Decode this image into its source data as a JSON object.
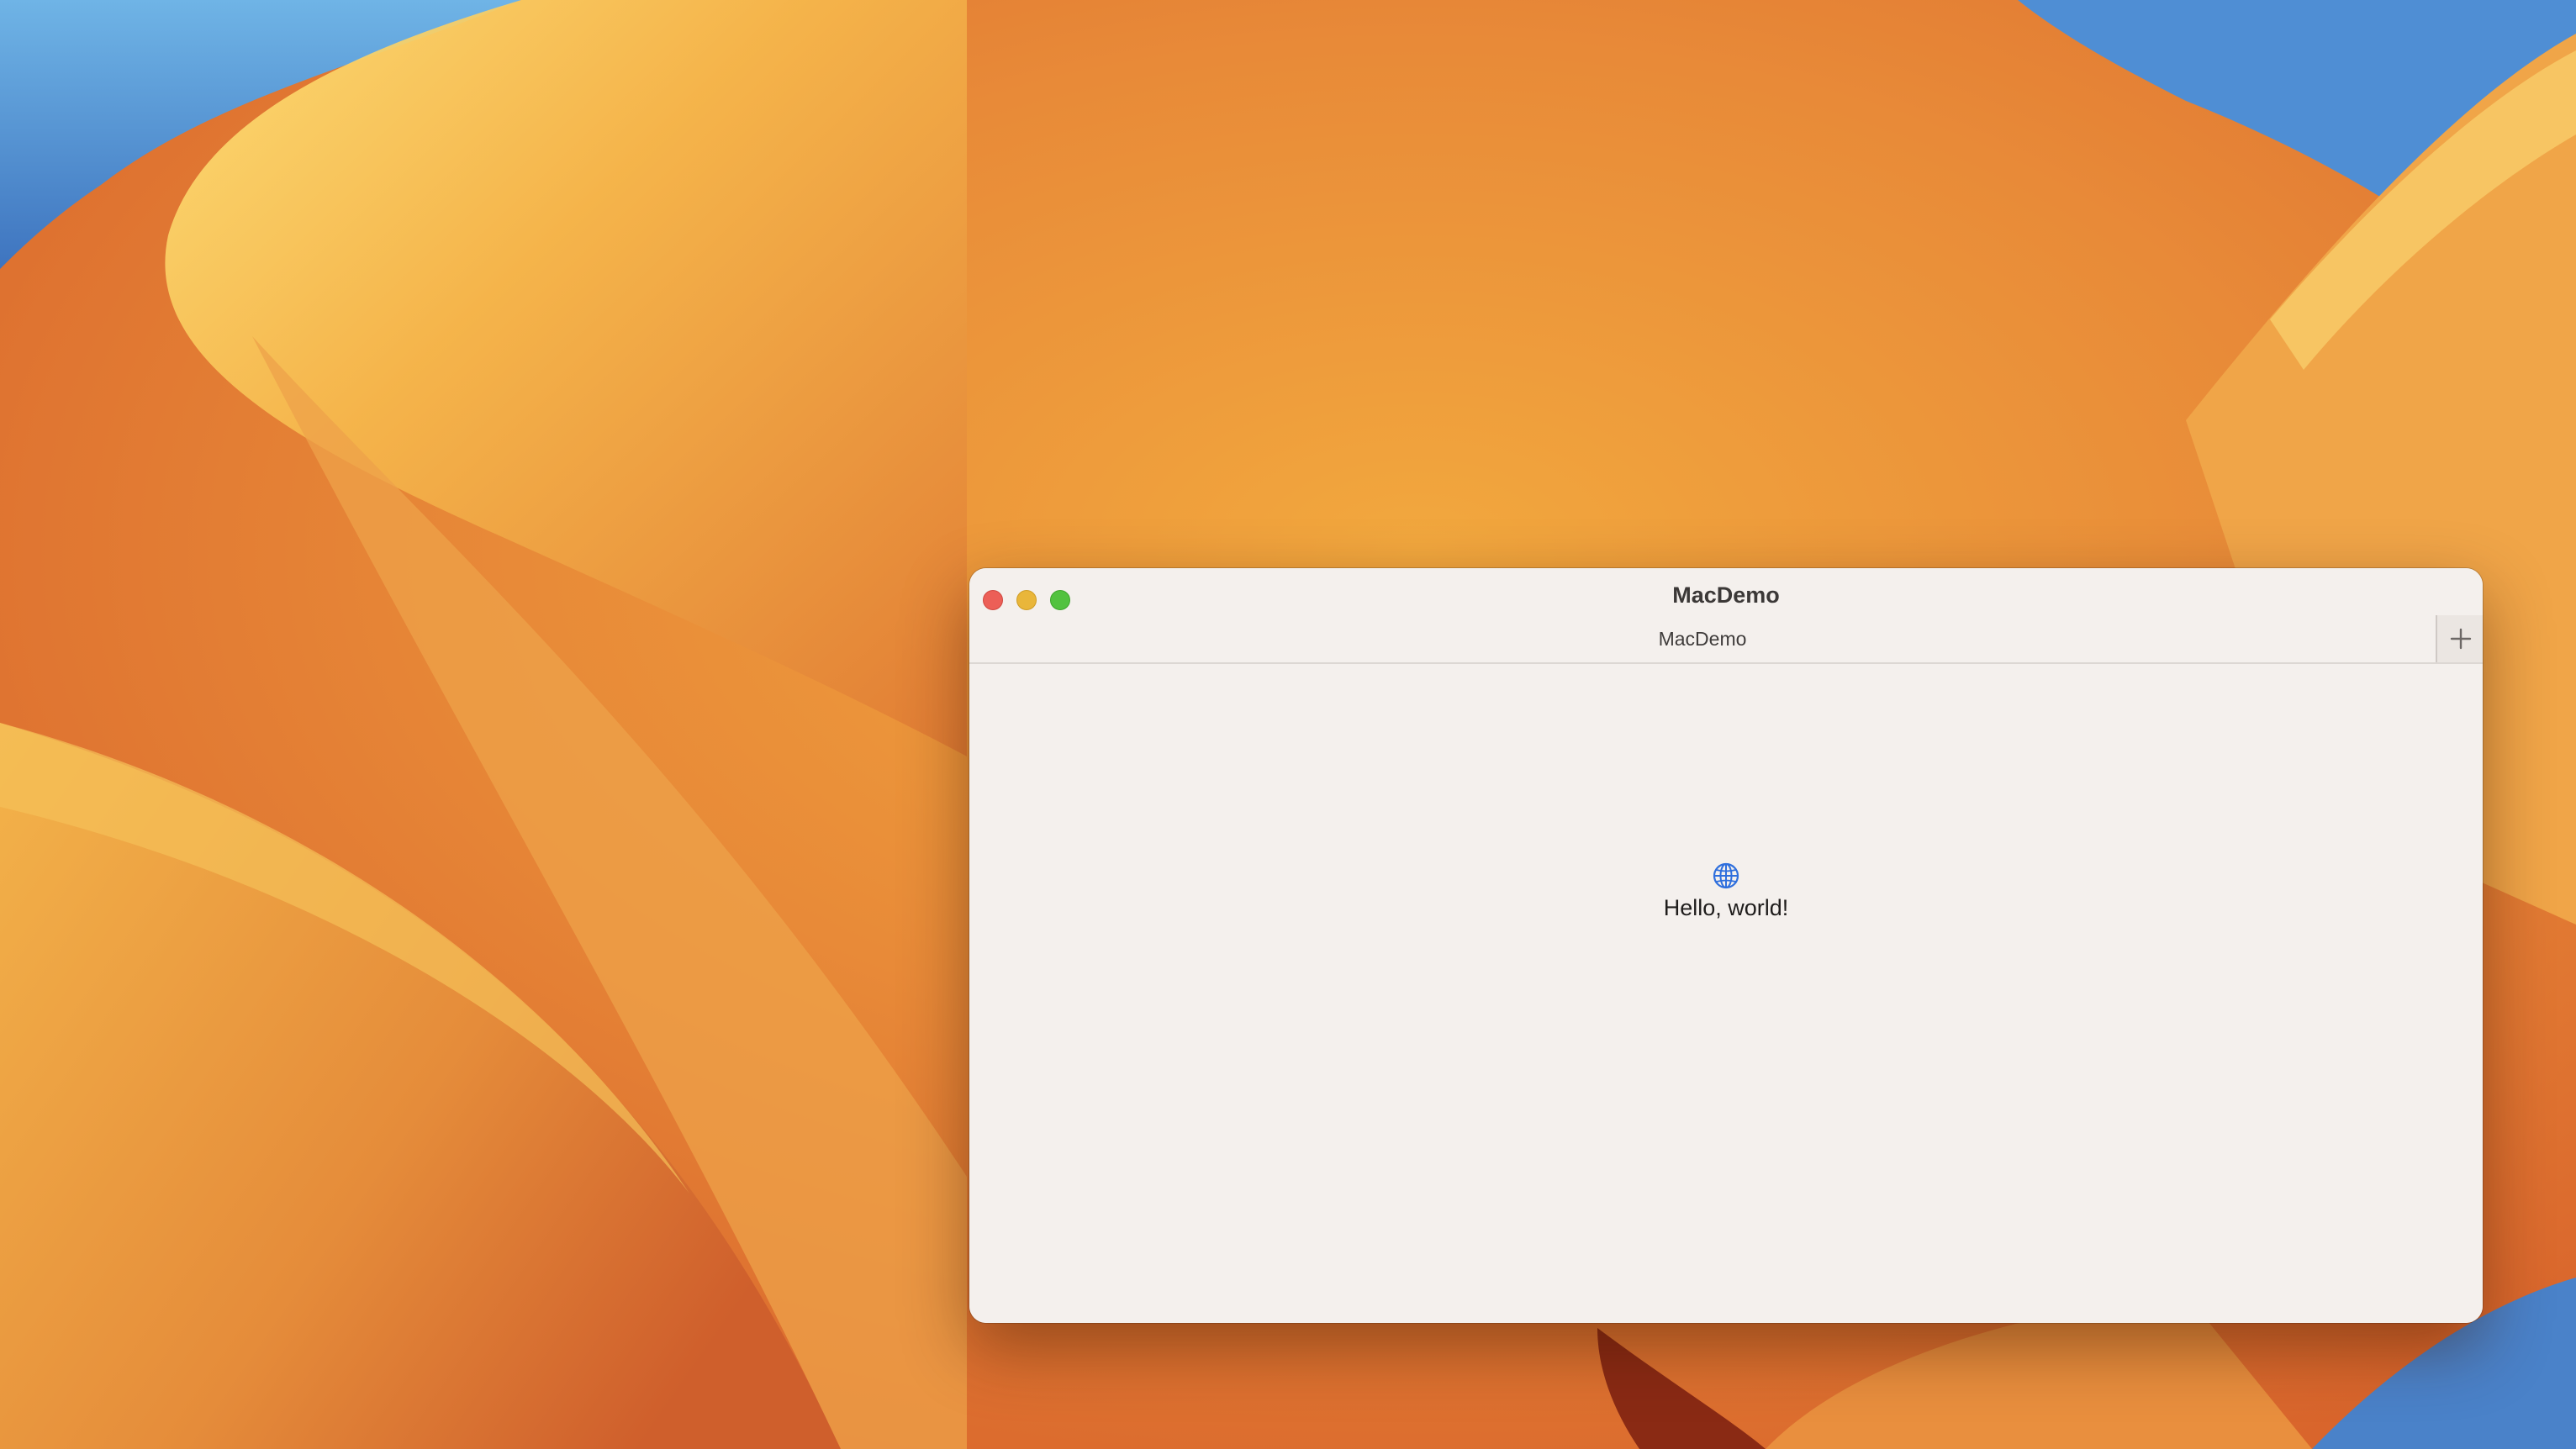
{
  "window": {
    "title": "MacDemo",
    "tab_label": "MacDemo",
    "new_tab_symbol": "+"
  },
  "content": {
    "greeting": "Hello, world!",
    "icon": "globe-icon"
  },
  "colors": {
    "close": "#ec5f57",
    "minimize": "#e9b63a",
    "zoom": "#52c23f",
    "globe_accent": "#2f6fdd",
    "window_bg": "#f4f0ed"
  }
}
